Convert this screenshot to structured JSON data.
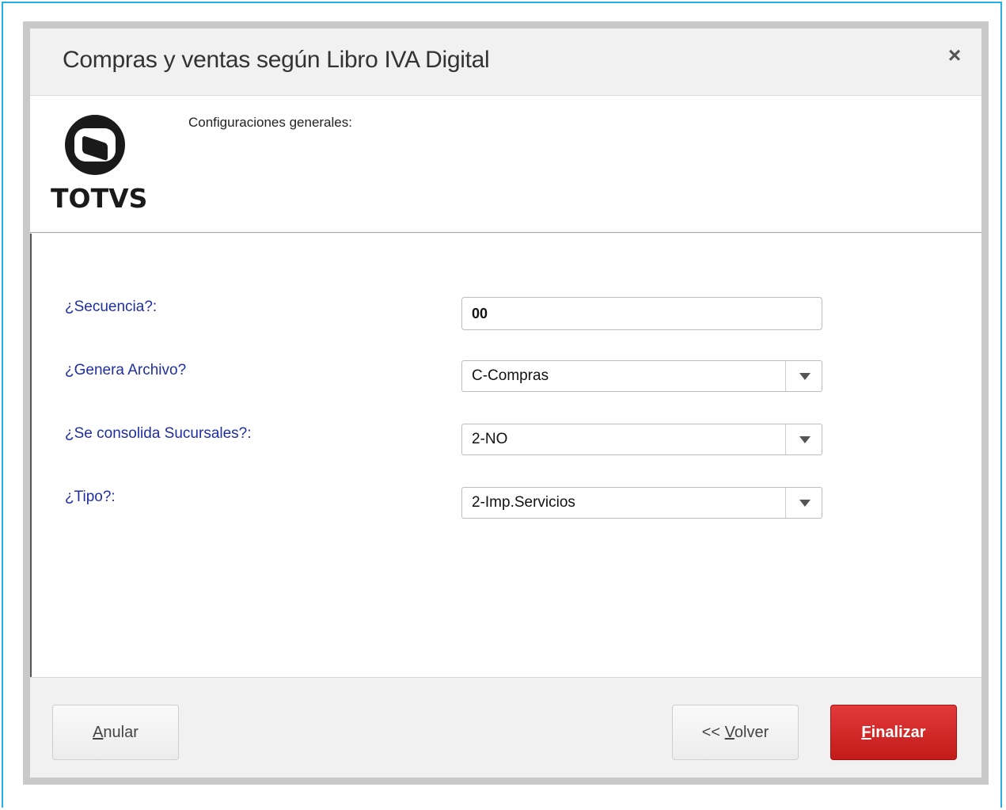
{
  "dialog": {
    "title": "Compras y ventas según Libro IVA Digital",
    "close_glyph": "×"
  },
  "header": {
    "logo_text": "TOTVS",
    "section_label": "Configuraciones generales:"
  },
  "form": {
    "fields": [
      {
        "label": "¿Secuencia?:",
        "type": "text",
        "value": "00"
      },
      {
        "label": "¿Genera Archivo?",
        "type": "select",
        "value": "C-Compras"
      },
      {
        "label": "¿Se consolida Sucursales?:",
        "type": "select",
        "value": "2-NO"
      },
      {
        "label": "¿Tipo?:",
        "type": "select",
        "value": "2-Imp.Servicios"
      }
    ]
  },
  "footer": {
    "cancel": {
      "mnemonic": "A",
      "rest": "nular"
    },
    "back": {
      "prefix": "<< ",
      "mnemonic": "V",
      "rest": "olver"
    },
    "finish": {
      "mnemonic": "F",
      "rest": "inalizar"
    }
  },
  "colors": {
    "frame_border": "#29aee3",
    "label_text": "#1f2fa0",
    "primary_button": "#c31a1a"
  },
  "icons": {
    "close": "close-icon",
    "logo": "totvs-logo-icon",
    "dropdown": "chevron-down-icon"
  }
}
